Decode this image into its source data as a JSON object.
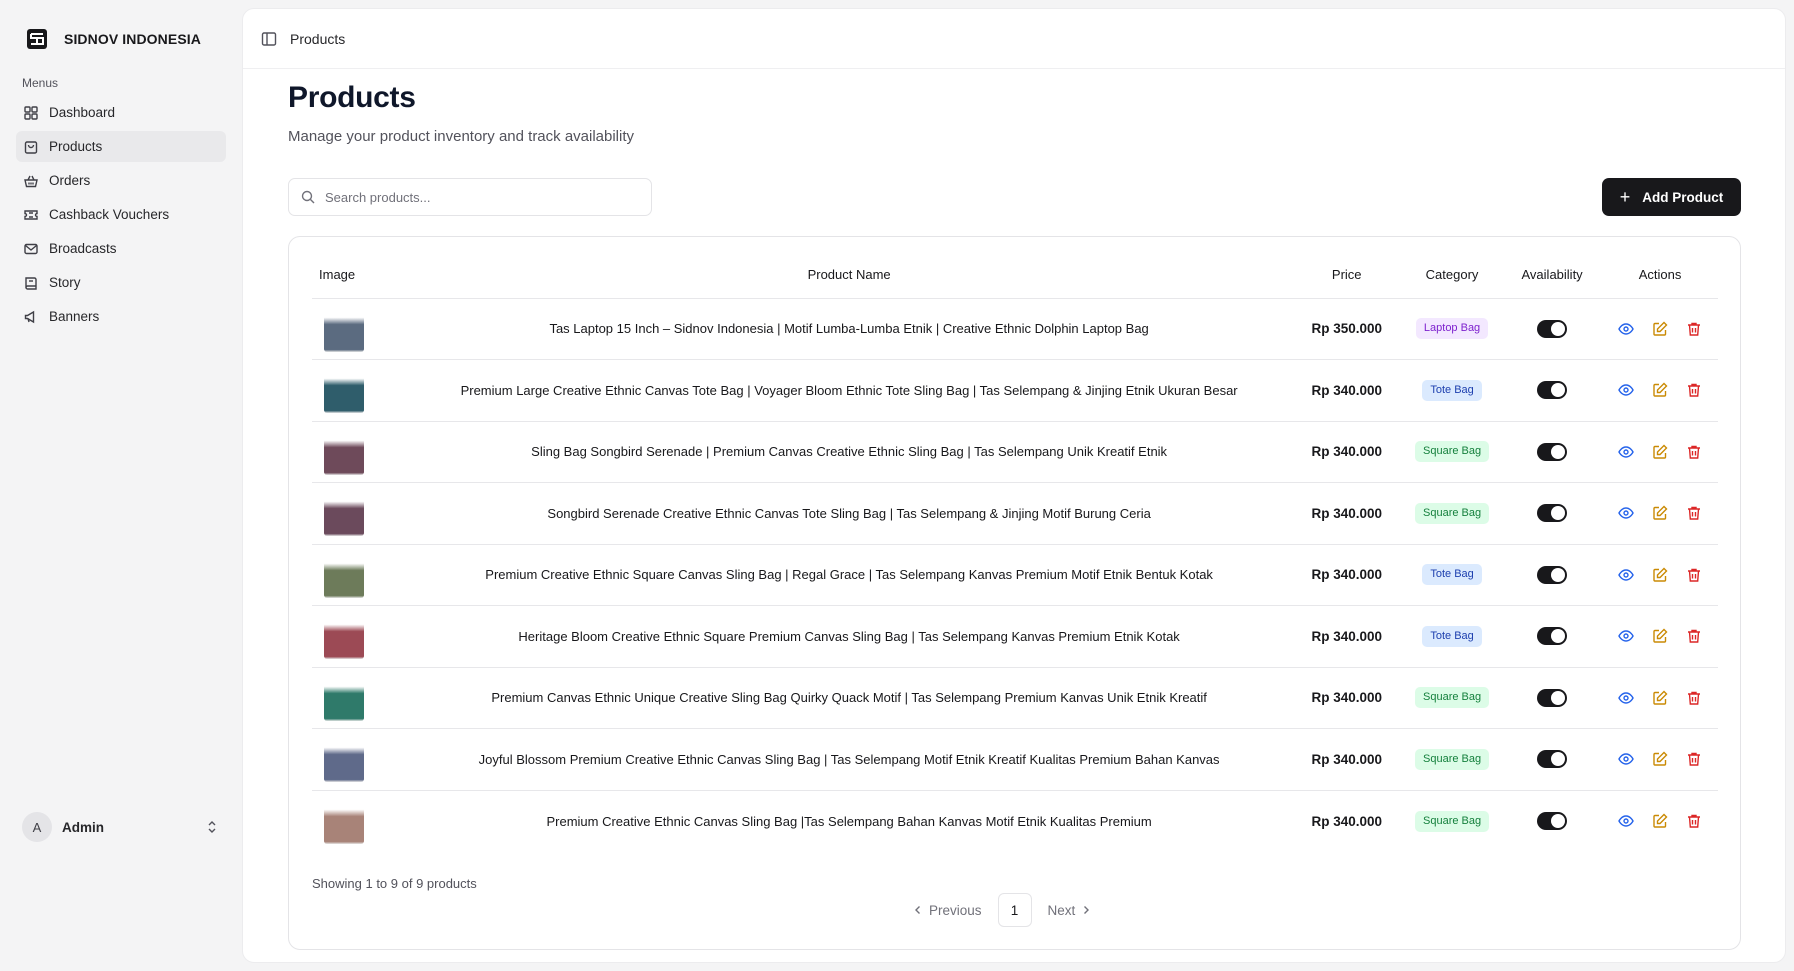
{
  "sidebar": {
    "brand": "SIDNOV INDONESIA",
    "menus_label": "Menus",
    "items": [
      {
        "label": "Dashboard",
        "icon": "grid-icon"
      },
      {
        "label": "Products",
        "icon": "shopping-bag-icon",
        "active": true
      },
      {
        "label": "Orders",
        "icon": "basket-icon"
      },
      {
        "label": "Cashback Vouchers",
        "icon": "ticket-icon"
      },
      {
        "label": "Broadcasts",
        "icon": "mail-icon"
      },
      {
        "label": "Story",
        "icon": "book-icon"
      },
      {
        "label": "Banners",
        "icon": "megaphone-icon"
      }
    ],
    "user": {
      "initial": "A",
      "name": "Admin"
    }
  },
  "topbar": {
    "breadcrumb": "Products"
  },
  "page": {
    "title": "Products",
    "subtitle": "Manage your product inventory and track availability"
  },
  "search": {
    "placeholder": "Search products...",
    "value": ""
  },
  "add_button": "Add Product",
  "table": {
    "headers": {
      "image": "Image",
      "name": "Product Name",
      "price": "Price",
      "category": "Category",
      "availability": "Availability",
      "actions": "Actions"
    },
    "rows": [
      {
        "name": "Tas Laptop 15 Inch – Sidnov Indonesia | Motif Lumba-Lumba Etnik | Creative Ethnic Dolphin Laptop Bag",
        "price": "Rp 350.000",
        "category": "Laptop Bag",
        "available": true,
        "thumb": "#5b6b80"
      },
      {
        "name": "Premium Large Creative Ethnic Canvas Tote Bag | Voyager Bloom Ethnic Tote Sling Bag | Tas Selempang & Jinjing Etnik Ukuran Besar",
        "price": "Rp 340.000",
        "category": "Tote Bag",
        "available": true,
        "thumb": "#2f5d6b"
      },
      {
        "name": "Sling Bag Songbird Serenade | Premium Canvas Creative Ethnic Sling Bag | Tas Selempang Unik Kreatif Etnik",
        "price": "Rp 340.000",
        "category": "Square Bag",
        "available": true,
        "thumb": "#6e4a5a"
      },
      {
        "name": "Songbird Serenade Creative Ethnic Canvas Tote Sling Bag | Tas Selempang & Jinjing Motif Burung Ceria",
        "price": "Rp 340.000",
        "category": "Square Bag",
        "available": true,
        "thumb": "#6b4a5c"
      },
      {
        "name": "Premium Creative Ethnic Square Canvas Sling Bag | Regal Grace | Tas Selempang Kanvas Premium Motif Etnik Bentuk Kotak",
        "price": "Rp 340.000",
        "category": "Tote Bag",
        "available": true,
        "thumb": "#6d7b5a"
      },
      {
        "name": "Heritage Bloom Creative Ethnic Square Premium Canvas Sling Bag | Tas Selempang Kanvas Premium Etnik Kotak",
        "price": "Rp 340.000",
        "category": "Tote Bag",
        "available": true,
        "thumb": "#9c4a55"
      },
      {
        "name": "Premium Canvas Ethnic Unique Creative Sling Bag Quirky Quack Motif | Tas Selempang Premium Kanvas Unik Etnik Kreatif",
        "price": "Rp 340.000",
        "category": "Square Bag",
        "available": true,
        "thumb": "#2f7a6a"
      },
      {
        "name": "Joyful Blossom Premium Creative Ethnic Canvas Sling Bag | Tas Selempang Motif Etnik Kreatif Kualitas Premium Bahan Kanvas",
        "price": "Rp 340.000",
        "category": "Square Bag",
        "available": true,
        "thumb": "#5f6a8a"
      },
      {
        "name": "Premium Creative Ethnic Canvas Sling Bag |Tas Selempang Bahan Kanvas Motif Etnik Kualitas Premium",
        "price": "Rp 340.000",
        "category": "Square Bag",
        "available": true,
        "thumb": "#a88378"
      }
    ]
  },
  "category_colors": {
    "Laptop Bag": {
      "bg": "#f3e8ff",
      "fg": "#7e22ce"
    },
    "Tote Bag": {
      "bg": "#dbeafe",
      "fg": "#1e40af"
    },
    "Square Bag": {
      "bg": "#dcfce7",
      "fg": "#15803d"
    }
  },
  "action_colors": {
    "view": "#2563eb",
    "edit": "#ca8a04",
    "delete": "#dc2626"
  },
  "footer": {
    "showing": "Showing 1 to 9 of 9 products",
    "previous": "Previous",
    "page": "1",
    "next": "Next"
  }
}
